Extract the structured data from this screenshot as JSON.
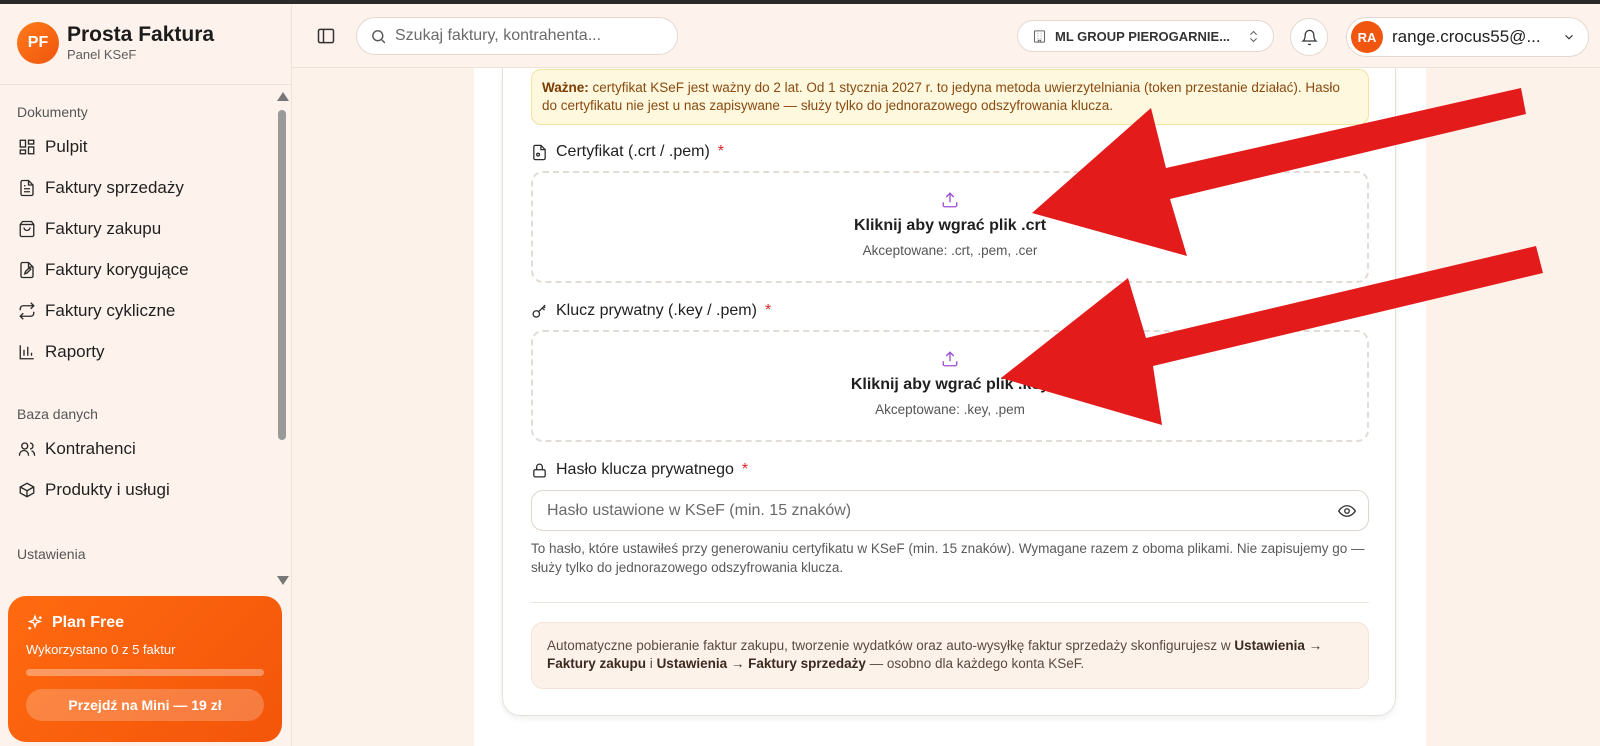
{
  "app": {
    "name": "Prosta Faktura",
    "subtitle": "Panel KSeF",
    "logo_initials": "PF",
    "accent_color": "#f0560e"
  },
  "sidebar": {
    "sections": [
      {
        "title": "Dokumenty",
        "items": [
          {
            "label": "Pulpit",
            "icon": "dashboard-icon"
          },
          {
            "label": "Faktury sprzedaży",
            "icon": "document-icon"
          },
          {
            "label": "Faktury zakupu",
            "icon": "shopping-bag-icon"
          },
          {
            "label": "Faktury korygujące",
            "icon": "document-edit-icon"
          },
          {
            "label": "Faktury cykliczne",
            "icon": "repeat-icon"
          },
          {
            "label": "Raporty",
            "icon": "bar-chart-icon"
          }
        ]
      },
      {
        "title": "Baza danych",
        "items": [
          {
            "label": "Kontrahenci",
            "icon": "users-icon"
          },
          {
            "label": "Produkty i usługi",
            "icon": "package-icon"
          }
        ]
      },
      {
        "title": "Ustawienia",
        "items": []
      }
    ],
    "plan": {
      "title": "Plan Free",
      "usage": "Wykorzystano 0 z 5 faktur",
      "usage_fraction": 0,
      "upgrade_label": "Przejdź na Mini — 19 zł"
    }
  },
  "header": {
    "search_placeholder": "Szukaj faktury, kontrahenta...",
    "company": "ML GROUP PIEROGARNIE...",
    "user_initials": "RA",
    "user_email": "range.crocus55@..."
  },
  "form": {
    "warning_bold": "Ważne:",
    "warning_text": "certyfikat KSeF jest ważny do 2 lat. Od 1 stycznia 2027 r. to jedyna metoda uwierzytelniania (token przestanie działać). Hasło do certyfikatu nie jest u nas zapisywane — służy tylko do jednorazowego odszyfrowania klucza.",
    "cert": {
      "label": "Certyfikat (.crt / .pem)",
      "required": "*",
      "dz_title": "Kliknij aby wgrać plik .crt",
      "dz_sub": "Akceptowane: .crt, .pem, .cer"
    },
    "key": {
      "label": "Klucz prywatny (.key / .pem)",
      "required": "*",
      "dz_title": "Kliknij aby wgrać plik .key",
      "dz_sub": "Akceptowane: .key, .pem"
    },
    "password": {
      "label": "Hasło klucza prywatnego",
      "required": "*",
      "placeholder": "Hasło ustawione w KSeF (min. 15 znaków)",
      "help": "To hasło, które ustawiłeś przy generowaniu certyfikatu w KSeF (min. 15 znaków). Wymagane razem z oboma plikami. Nie zapisujemy go — służy tylko do jednorazowego odszyfrowania klucza."
    },
    "info": {
      "prefix": "Automatyczne pobieranie faktur zakupu, tworzenie wydatków oraz auto-wysyłkę faktur sprzedaży skonfigurujesz w",
      "link1": "Ustawienia → Faktury zakupu",
      "mid": "i",
      "link2": "Ustawienia → Faktury sprzedaży",
      "suffix": "— osobno dla każdego konta KSeF."
    }
  },
  "annotation_color": "#e31b1b"
}
